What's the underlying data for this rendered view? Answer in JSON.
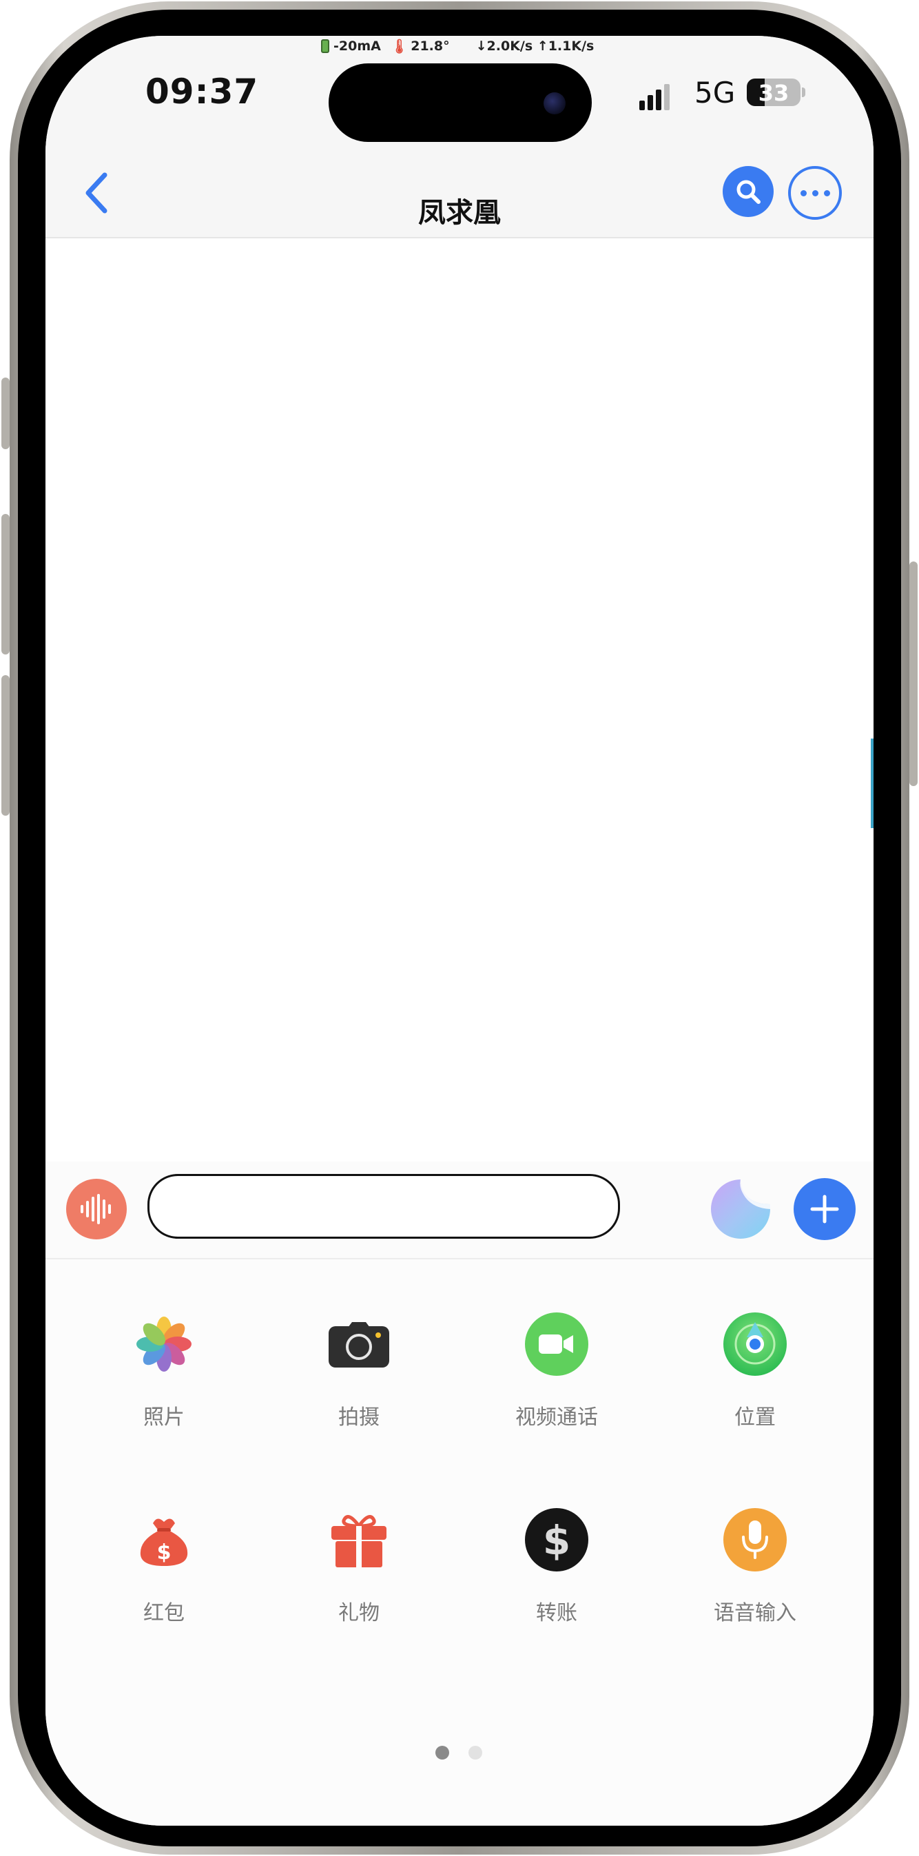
{
  "device_status_overlay": {
    "current": "-20mA",
    "temperature": "21.8°",
    "net_speed": "↓2.0K/s ↑1.1K/s"
  },
  "status_bar": {
    "time": "09:37",
    "network": "5G",
    "battery": "33",
    "battery_level": 0.33
  },
  "header": {
    "title": "凤求凰",
    "back_icon": "chevron-left-icon",
    "search_icon": "search-icon",
    "more_icon": "more-icon"
  },
  "input_bar": {
    "voice_icon": "voice-waveform-icon",
    "placeholder": "",
    "sticker_icon": "sticker-icon",
    "plus_icon": "plus-icon"
  },
  "panel": {
    "items": [
      {
        "label": "照片",
        "icon": "photos-icon"
      },
      {
        "label": "拍摄",
        "icon": "camera-icon"
      },
      {
        "label": "视频通话",
        "icon": "video-call-icon"
      },
      {
        "label": "位置",
        "icon": "location-icon"
      },
      {
        "label": "红包",
        "icon": "red-packet-icon"
      },
      {
        "label": "礼物",
        "icon": "gift-icon"
      },
      {
        "label": "转账",
        "icon": "transfer-icon"
      },
      {
        "label": "语音输入",
        "icon": "microphone-icon"
      }
    ],
    "page_count": 2,
    "current_page": 1
  },
  "colors": {
    "accent": "#3a7bf1",
    "voice": "#ef7c66",
    "red": "#e95743",
    "green": "#5fd05c",
    "orange": "#f3a33a"
  }
}
